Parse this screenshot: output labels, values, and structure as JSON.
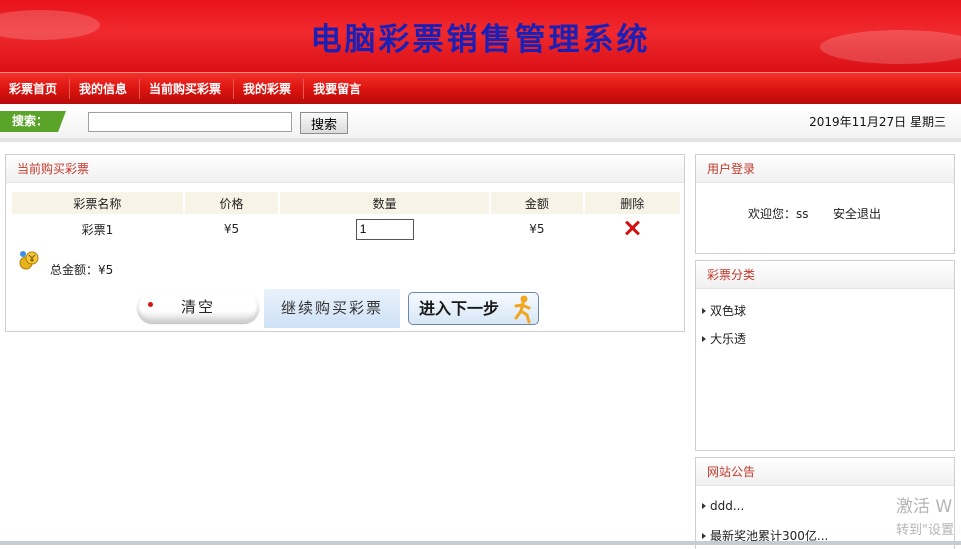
{
  "banner": {
    "title": "电脑彩票销售管理系统"
  },
  "nav": {
    "items": [
      "彩票首页",
      "我的信息",
      "当前购买彩票",
      "我的彩票",
      "我要留言"
    ]
  },
  "search": {
    "tag": "搜索：",
    "placeholder": "",
    "value": "",
    "button": "搜索",
    "date": "2019年11月27日 星期三"
  },
  "cart": {
    "title": "当前购买彩票",
    "columns": [
      "彩票名称",
      "价格",
      "数量",
      "金额",
      "删除"
    ],
    "rows": [
      {
        "name": "彩票1",
        "price": "¥5",
        "qty": "1",
        "amount": "¥5"
      }
    ],
    "total_label": "总金额：¥5",
    "buttons": {
      "clear": "清空",
      "continue": "继续购买彩票",
      "next": "进入下一步"
    }
  },
  "login": {
    "title": "用户登录",
    "welcome": "欢迎您：ss",
    "logout": "安全退出"
  },
  "category": {
    "title": "彩票分类",
    "items": [
      "双色球",
      "大乐透"
    ]
  },
  "notice": {
    "title": "网站公告",
    "items": [
      "ddd...",
      "最新奖池累计300亿..."
    ]
  },
  "watermark": {
    "line1": "激活 W",
    "line2": "转到\"设置"
  },
  "colors": {
    "banner_red": "#e8121a",
    "title_blue": "#1c1fb5",
    "panel_title": "#c0392b",
    "search_green": "#5aa529"
  }
}
